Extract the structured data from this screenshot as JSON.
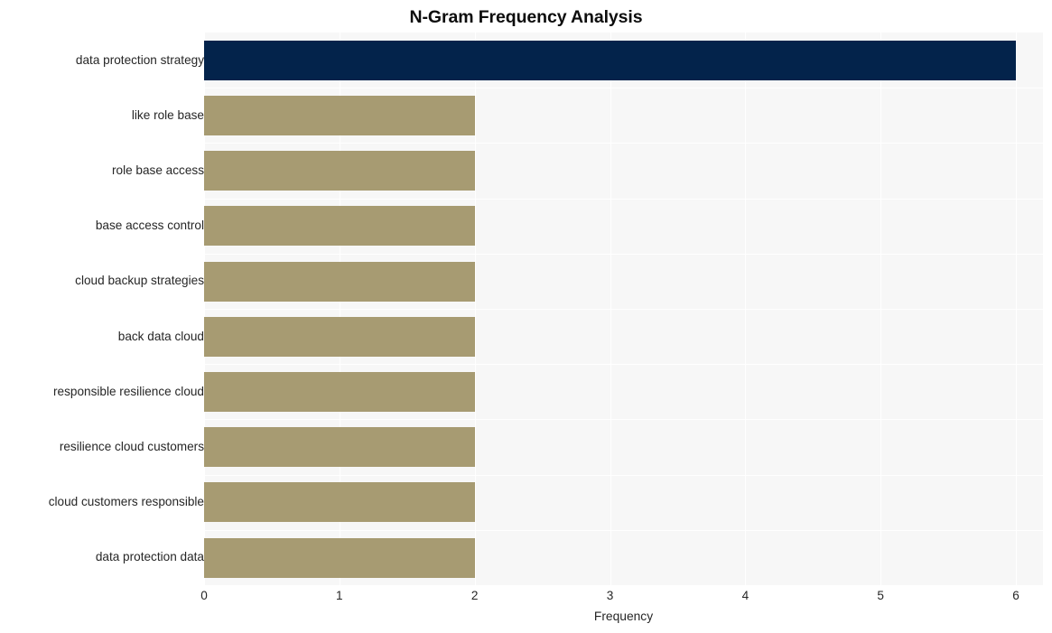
{
  "chart_data": {
    "type": "bar",
    "orientation": "horizontal",
    "title": "N-Gram Frequency Analysis",
    "xlabel": "Frequency",
    "ylabel": "",
    "xlim": [
      0,
      6.2
    ],
    "xticks": [
      "0",
      "1",
      "2",
      "3",
      "4",
      "5",
      "6"
    ],
    "xtick_values": [
      0,
      1,
      2,
      3,
      4,
      5,
      6
    ],
    "grid": true,
    "legend": false,
    "categories": [
      "data protection strategy",
      "like role base",
      "role base access",
      "base access control",
      "cloud backup strategies",
      "back data cloud",
      "responsible resilience cloud",
      "resilience cloud customers",
      "cloud customers responsible",
      "data protection data"
    ],
    "values": [
      6,
      2,
      2,
      2,
      2,
      2,
      2,
      2,
      2,
      2
    ],
    "bar_colors": [
      "#03234b",
      "#a79b72",
      "#a79b72",
      "#a79b72",
      "#a79b72",
      "#a79b72",
      "#a79b72",
      "#a79b72",
      "#a79b72",
      "#a79b72"
    ]
  },
  "style": {
    "figure_background": "#ffffff",
    "plot_background": "#f7f7f7",
    "gridline_color": "#ffffff",
    "tick_label_color": "#262626",
    "title_color": "#0d0d0d",
    "highlight_color": "#03234b",
    "base_bar_color": "#a79b72"
  }
}
